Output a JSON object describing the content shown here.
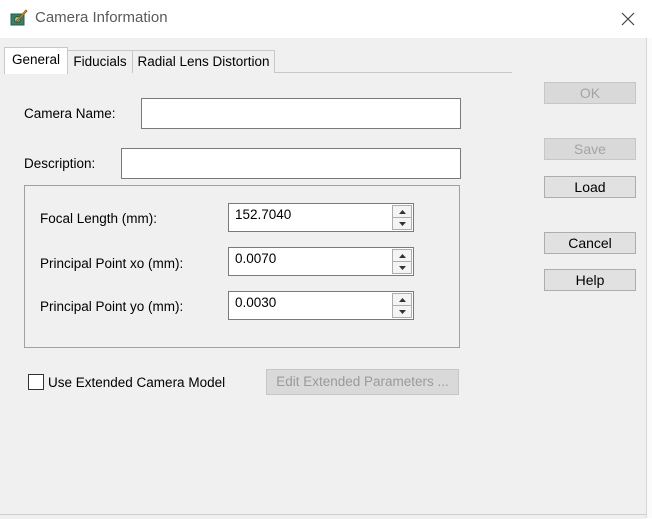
{
  "window": {
    "title": "Camera Information",
    "icon": "camera-pencil-icon"
  },
  "tabs": [
    {
      "label": "General",
      "active": true
    },
    {
      "label": "Fiducials",
      "active": false
    },
    {
      "label": "Radial Lens Distortion",
      "active": false
    }
  ],
  "general": {
    "camera_name_label": "Camera Name:",
    "camera_name_value": "",
    "description_label": "Description:",
    "description_value": "",
    "focal_length_label": "Focal Length (mm):",
    "focal_length_value": "152.7040",
    "principal_xo_label": "Principal Point xo (mm):",
    "principal_xo_value": "0.0070",
    "principal_yo_label": "Principal Point yo (mm):",
    "principal_yo_value": "0.0030",
    "extended_model_label": "Use Extended Camera Model",
    "extended_model_checked": false,
    "edit_extended_label": "Edit Extended Parameters ..."
  },
  "buttons": {
    "ok": "OK",
    "save": "Save",
    "load": "Load",
    "cancel": "Cancel",
    "help": "Help"
  }
}
